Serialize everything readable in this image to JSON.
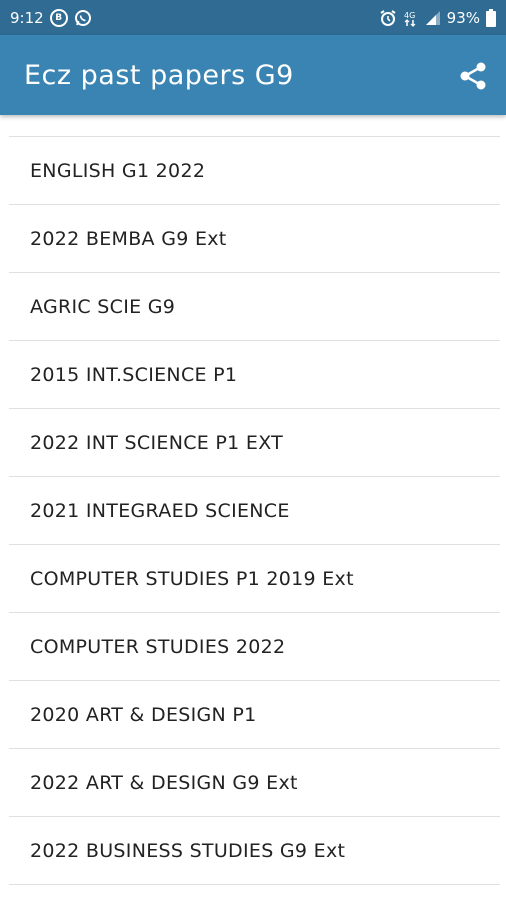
{
  "status_bar": {
    "time": "9:12",
    "battery": "93%",
    "icons": [
      "b-circle-icon",
      "whatsapp-icon",
      "alarm-icon",
      "signal-4g-icon",
      "signal-bars-icon",
      "battery-icon"
    ],
    "color": "#2f6b92"
  },
  "app_bar": {
    "title": "Ecz past papers G9",
    "color": "#3a84b3",
    "share_icon": "share-icon"
  },
  "list": {
    "items": [
      "ENGLISH G1 2022",
      "2022 BEMBA G9 Ext",
      "AGRIC SCIE G9",
      "2015 INT.SCIENCE P1",
      "2022 INT SCIENCE P1 EXT",
      "2021 INTEGRAED SCIENCE",
      "COMPUTER STUDIES P1 2019 Ext",
      "COMPUTER STUDIES 2022",
      "2020 ART & DESIGN P1",
      "2022 ART & DESIGN G9 Ext",
      "2022 BUSINESS STUDIES G9 Ext"
    ]
  }
}
